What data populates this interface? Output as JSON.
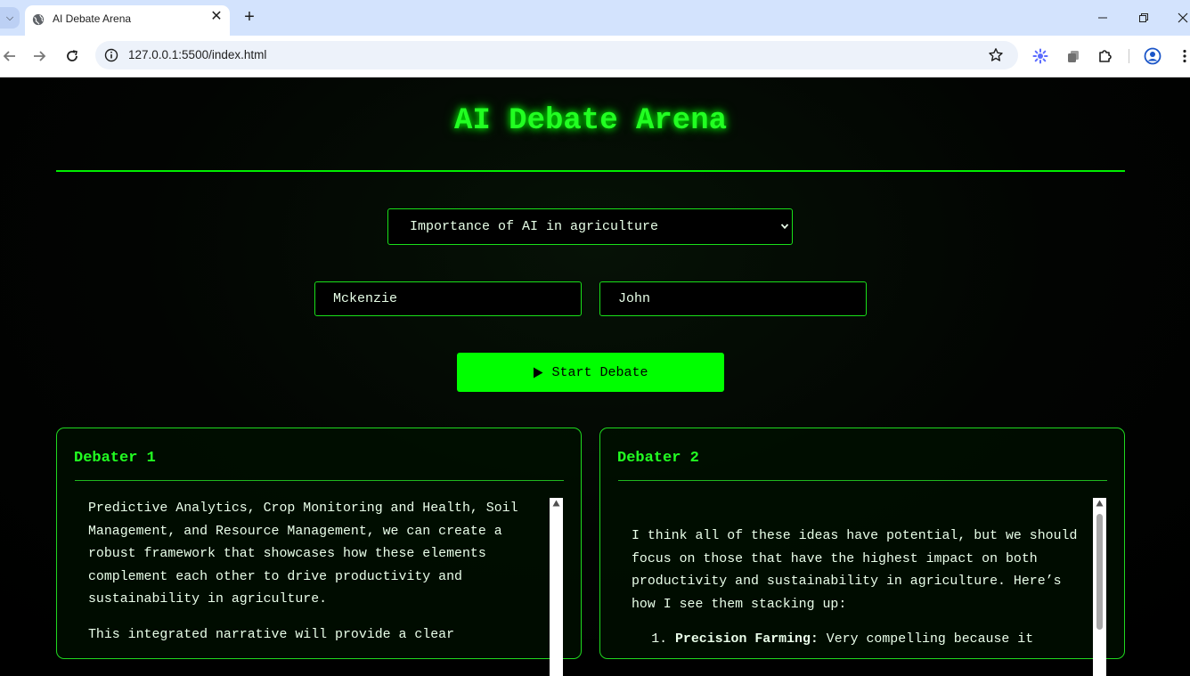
{
  "browser": {
    "tab_title": "AI Debate Arena",
    "url": "127.0.0.1:5500/index.html"
  },
  "app": {
    "title": "AI Debate Arena",
    "topic_selected": "Importance of AI in agriculture",
    "debater1_name": "Mckenzie",
    "debater2_name": "John",
    "start_label": "Start Debate"
  },
  "panels": {
    "debater1": {
      "title": "Debater 1",
      "paragraphs": [
        "Predictive Analytics, Crop Monitoring and Health, Soil Management, and Resource Management, we can create a robust framework that showcases how these elements complement each other to drive productivity and sustainability in agriculture.",
        "This integrated narrative will provide a clear"
      ]
    },
    "debater2": {
      "title": "Debater 2",
      "paragraphs": [
        "I think all of these ideas have potential, but we should focus on those that have the highest impact on both productivity and sustainability in agriculture. Here’s how I see them stacking up:"
      ],
      "list_item_1_bold": "Precision Farming:",
      "list_item_1_rest": " Very compelling because it"
    }
  },
  "colors": {
    "accent": "#00ff00",
    "background": "#000000"
  }
}
